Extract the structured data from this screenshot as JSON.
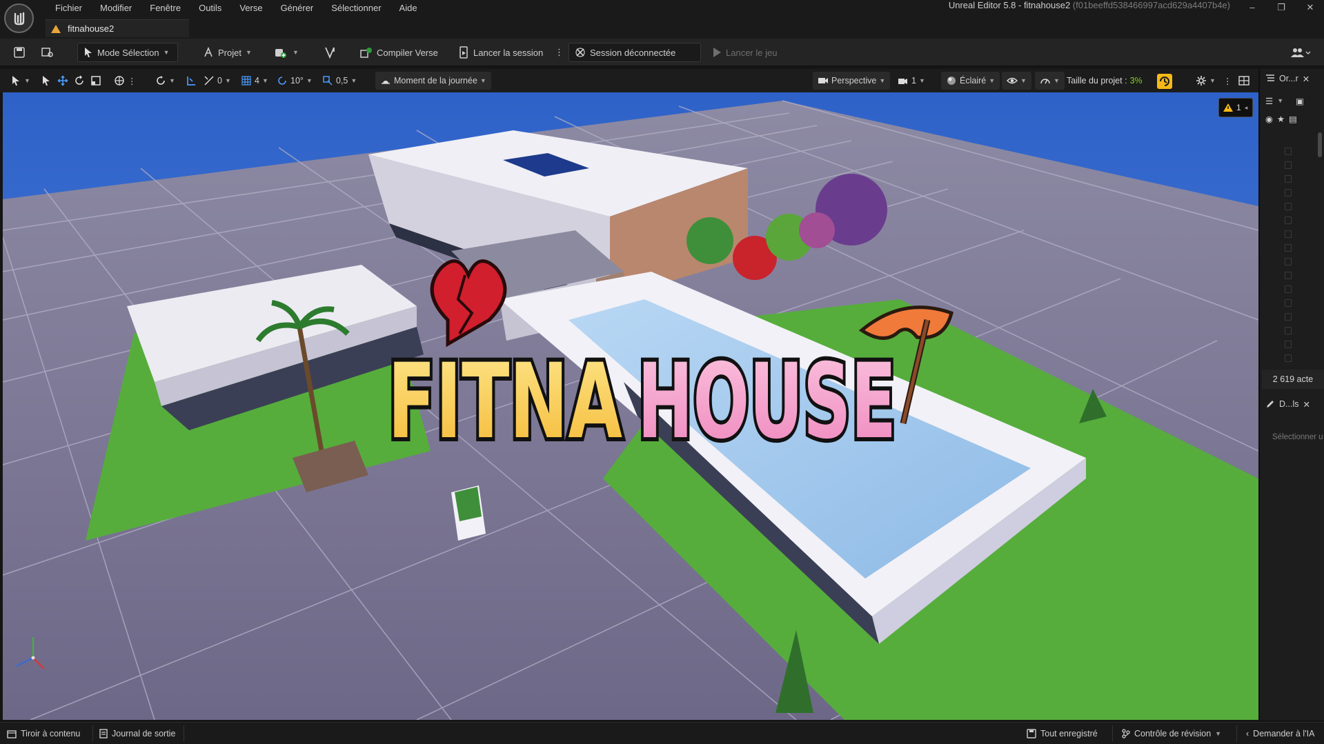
{
  "app": {
    "window_title": "Unreal Editor 5.8 - fitnahouse2",
    "window_hash": "(f01beeffd538466997acd629a4407b4e)"
  },
  "menu": [
    "Fichier",
    "Modifier",
    "Fenêtre",
    "Outils",
    "Verse",
    "Générer",
    "Sélectionner",
    "Aide"
  ],
  "tab": {
    "label": "fitnahouse2"
  },
  "toolbar": {
    "mode": "Mode Sélection",
    "project": "Projet",
    "compile": "Compiler Verse",
    "launch_session": "Lancer la session",
    "session_status": "Session déconnectée",
    "launch_game": "Lancer le jeu"
  },
  "viewport_toolbar": {
    "rotate_snap_count": "0",
    "grid_snap": "4",
    "angle_snap": "10°",
    "scale_snap": "0,5",
    "time_of_day": "Moment de la journée",
    "view_mode": "Perspective",
    "camera_speed": "1",
    "lighting": "Éclairé",
    "project_size_label": "Taille du projet :",
    "project_size_value": "3%"
  },
  "viewport": {
    "warning_count": "1",
    "logo_word1": "FITNA",
    "logo_word2": "HOUSE"
  },
  "outliner": {
    "tab_label": "Or...r",
    "actor_count": "2 619 acte",
    "details_tab_label": "D...ls",
    "details_hint": "Sélectionner u"
  },
  "statusbar": {
    "content_drawer": "Tiroir à contenu",
    "output_log": "Journal de sortie",
    "save_all": "Tout enregistré",
    "revision_control": "Contrôle de révision",
    "ask_ai": "Demander à l'IA"
  },
  "colors": {
    "accent_yellow": "#f6b917",
    "success_green": "#7ed321",
    "sky_blue": "#3a6ad0",
    "logo_yellow": "#fcd34d",
    "logo_pink": "#f49ac8"
  }
}
